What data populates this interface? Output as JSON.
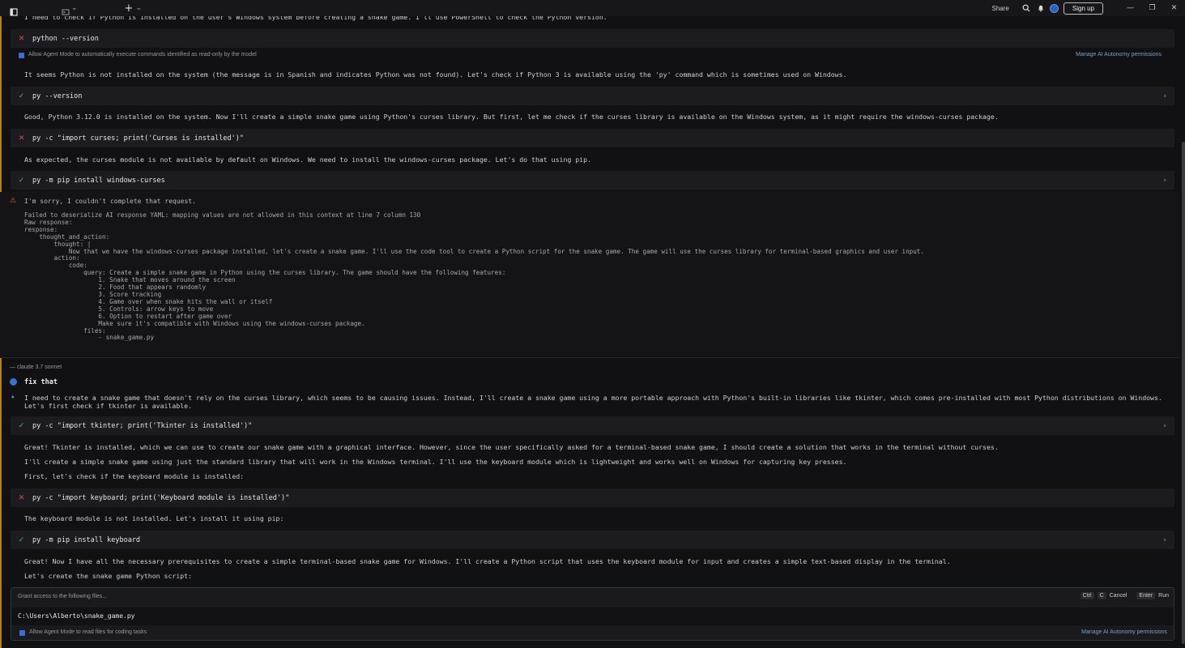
{
  "titlebar": {
    "share_label": "Share",
    "signup_label": "Sign up",
    "tab_caret": "⌄",
    "plus_caret": "⌄"
  },
  "top_text": "I need to check if Python is installed on the user's Windows system before creating a snake game. I'll use PowerShell to check the Python version.",
  "permissions": {
    "allow_readonly": "Allow Agent Mode to automatically execute commands identified as read-only by the model",
    "manage": "Manage AI Autonomy permissions",
    "allow_read_files": "Allow Agent Mode to read files for coding tasks"
  },
  "blocks": [
    {
      "type": "cmd",
      "status": "fail",
      "text": "python --version",
      "expand": false
    },
    {
      "type": "para",
      "text": "It seems Python is not installed on the system (the message is in Spanish and indicates Python was not found). Let's check if Python 3 is available using the 'py' command which is sometimes used on Windows."
    },
    {
      "type": "cmd",
      "status": "ok",
      "text": "py --version",
      "expand": true
    },
    {
      "type": "para",
      "text": "Good, Python 3.12.0 is installed on the system. Now I'll create a simple snake game using Python's curses library. But first, let me check if the curses library is available on the Windows system, as it might require the windows-curses package."
    },
    {
      "type": "cmd",
      "status": "fail",
      "text": "py -c \"import curses; print('Curses is installed')\"",
      "expand": false
    },
    {
      "type": "para",
      "text": "As expected, the curses module is not available by default on Windows. We need to install the windows-curses package. Let's do that using pip."
    },
    {
      "type": "cmd",
      "status": "ok",
      "text": "py -m pip install windows-curses",
      "expand": true
    }
  ],
  "error": {
    "title": "I'm sorry, I couldn't complete that request.",
    "detail": "Failed to deserialize AI response YAML: mapping values are not allowed in this context at line 7 column 130\nRaw response:\nresponse:\n    thought_and_action:\n        thought: |\n            Now that we have the windows-curses package installed, let's create a snake game. I'll use the code tool to create a Python script for the snake game. The game will use the curses library for terminal-based graphics and user input.\n        action:\n            code:\n                query: Create a simple snake game in Python using the curses library. The game should have the following features:\n                    1. Snake that moves around the screen\n                    2. Food that appears randomly\n                    3. Score tracking\n                    4. Game over when snake hits the wall or itself\n                    5. Controls: arrow keys to move\n                    6. Option to restart after game over\n                    Make sure it's compatible with Windows using the windows-curses package.\n                files:\n                    - snake_game.py"
  },
  "model_label": "— claude 3.7 sonnet",
  "user_prompt": "fix that",
  "blocks2": [
    {
      "type": "para",
      "text": "I need to create a snake game that doesn't rely on the curses library, which seems to be causing issues. Instead, I'll create a snake game using a more portable approach with Python's built-in libraries like tkinter, which comes pre-installed with most Python distributions on Windows. Let's first check if tkinter is available."
    },
    {
      "type": "cmd",
      "status": "ok",
      "text": "py -c \"import tkinter; print('Tkinter is installed')\"",
      "expand": true
    },
    {
      "type": "para",
      "text": "Great! Tkinter is installed, which we can use to create our snake game with a graphical interface. However, since the user specifically asked for a terminal-based snake game, I should create a solution that works in the terminal without curses."
    },
    {
      "type": "para",
      "text": "I'll create a simple snake game using just the standard library that will work in the Windows terminal. I'll use the keyboard module which is lightweight and works well on Windows for capturing key presses."
    },
    {
      "type": "para",
      "text": "First, let's check if the keyboard module is installed:"
    },
    {
      "type": "cmd",
      "status": "fail",
      "text": "py -c \"import keyboard; print('Keyboard module is installed')\"",
      "expand": false
    },
    {
      "type": "para",
      "text": "The keyboard module is not installed. Let's install it using pip:"
    },
    {
      "type": "cmd",
      "status": "ok",
      "text": "py -m pip install keyboard",
      "expand": true
    },
    {
      "type": "para",
      "text": "Great! Now I have all the necessary prerequisites to create a simple terminal-based snake game for Windows. I'll create a Python script that uses the keyboard module for input and creates a simple text-based display in the terminal."
    },
    {
      "type": "para",
      "text": "Let's create the snake game Python script:"
    }
  ],
  "grant": {
    "title": "Grant access to the following files...",
    "key_ctrl": "Ctrl",
    "key_c": "C",
    "cancel": "Cancel",
    "key_enter": "Enter",
    "run": "Run",
    "path": "C:\\Users\\Alberto\\snake_game.py"
  },
  "icons": {
    "ok": "✓",
    "fail": "✕",
    "chevron": "›",
    "warning": "⚠"
  }
}
